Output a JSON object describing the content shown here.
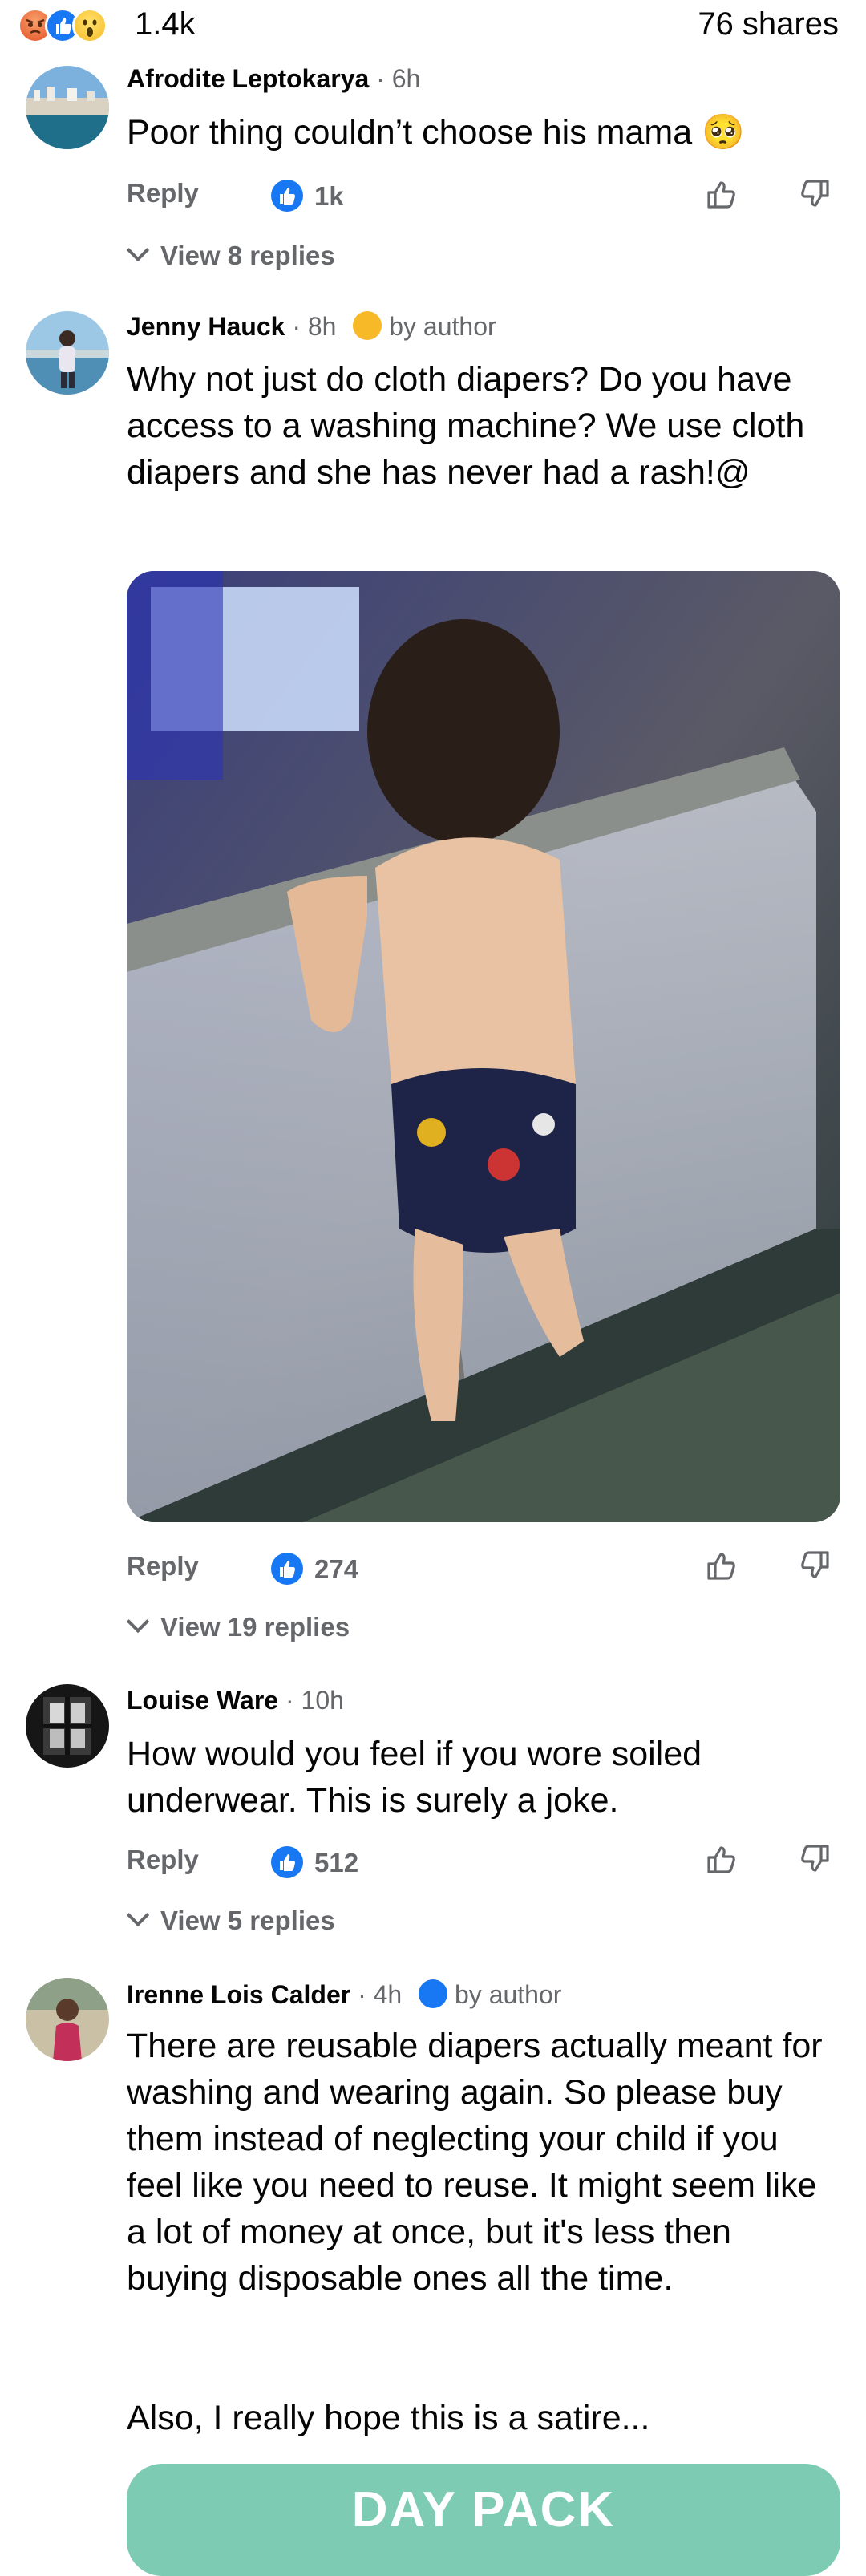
{
  "top_bar": {
    "reaction_count": "1.4k",
    "shares": "76 shares",
    "reaction_icons": [
      "angry-icon",
      "like-icon",
      "wow-icon"
    ]
  },
  "comments": [
    {
      "author": "Afrodite Leptokarya",
      "time": "6h",
      "text": "Poor thing couldn’t choose his mama 🥺",
      "reply_label": "Reply",
      "like_count": "1k",
      "view_replies": "View 8 replies"
    },
    {
      "author": "Jenny Hauck",
      "time": "8h",
      "badge": "by author",
      "text": "Why not just do cloth diapers?  Do you have access to a washing machine?  We use cloth diapers and she has never had a rash!@",
      "reply_label": "Reply",
      "like_count": "274",
      "view_replies": "View 19 replies"
    },
    {
      "author": "Louise Ware",
      "time": "10h",
      "text": "How would you feel if you wore soiled underwear. This is surely a joke.",
      "reply_label": "Reply",
      "like_count": "512",
      "view_replies": "View 5 replies"
    },
    {
      "author": "Irenne Lois Calder",
      "time": "4h",
      "badge": "by author",
      "text": "There are reusable diapers actually meant for washing and wearing again. So please buy them instead of neglecting your child if you feel like you need to reuse. It might seem like a lot of money at once, but it's less then buying disposable ones all the time.",
      "text2": "Also, I really hope this is a satire..."
    }
  ],
  "ad_banner": {
    "text": "DAY PACK"
  },
  "colors": {
    "brand_blue": "#1877f2",
    "meta_gray": "#65676b",
    "ad_teal": "#7ecbb3"
  }
}
